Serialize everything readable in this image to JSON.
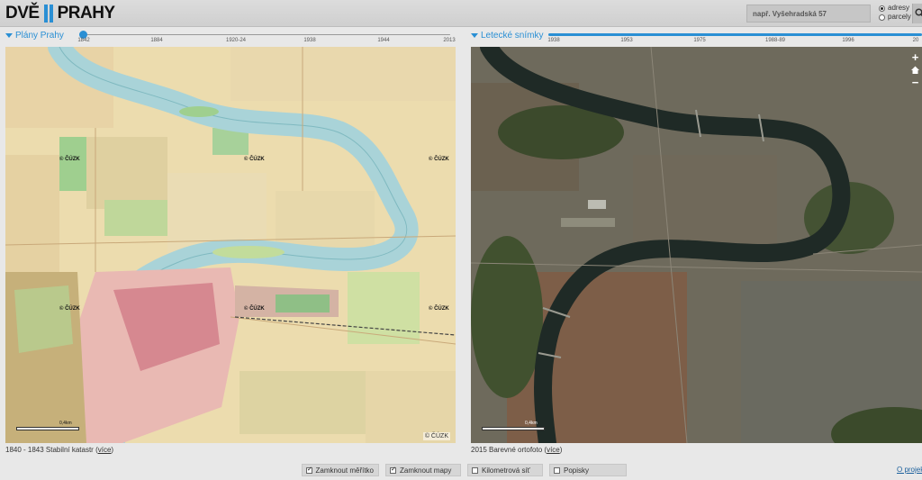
{
  "header": {
    "logo_left": "DVĚ",
    "logo_right": "PRAHY",
    "search_placeholder": "např. Vyšehradská 57",
    "radio_options": [
      {
        "label": "adresy",
        "selected": true
      },
      {
        "label": "parcely",
        "selected": false
      }
    ],
    "search_icon": "magnifier-icon"
  },
  "left_panel": {
    "title": "Plány Prahy",
    "timeline_years": [
      "1842",
      "1884",
      "1920-24",
      "1938",
      "1944",
      "2013"
    ],
    "selected_year": "1842",
    "watermarks": [
      "© ČÚZK",
      "© ČÚZK",
      "© ČÚZK",
      "© ČÚZK",
      "© ČÚZK",
      "© ČÚZK"
    ],
    "scale_label": "0,4km",
    "copyright": "© ČÚZK",
    "caption_text": "1840 - 1843 Stabilní katastr (",
    "caption_link": "více",
    "caption_end": ")"
  },
  "right_panel": {
    "title": "Letecké snímky",
    "timeline_years": [
      "1938",
      "1953",
      "1975",
      "1988-89",
      "1996",
      "20"
    ],
    "selected_year": "2015",
    "controls": {
      "zoom_in": "+",
      "zoom_out": "−",
      "home_icon": "home-icon"
    },
    "scale_label": "0,4km",
    "caption_text": "2015 Barevné ortofoto (",
    "caption_link": "více",
    "caption_end": ")"
  },
  "toolbar": [
    {
      "label": "Zamknout měřítko",
      "checked": true
    },
    {
      "label": "Zamknout mapy",
      "checked": true
    },
    {
      "label": "Kilometrová síť",
      "checked": false
    },
    {
      "label": "Popisky",
      "checked": false
    }
  ],
  "footer": {
    "project_link": "O projek"
  },
  "colors": {
    "accent": "#2a8fd4",
    "river_map": "#a9d3d8",
    "river_aerial": "#1f2a26"
  }
}
